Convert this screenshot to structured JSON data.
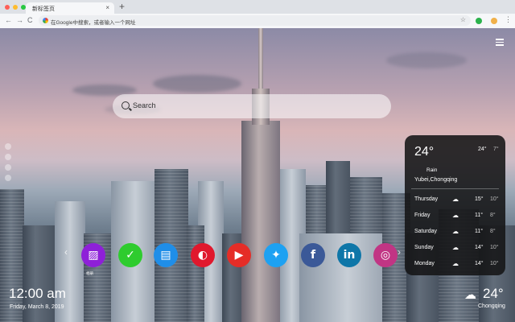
{
  "browser": {
    "tab_title": "新标签页",
    "tab_close": "×",
    "new_tab": "+",
    "back": "←",
    "forward": "→",
    "reload": "C",
    "omnibox_placeholder": "在Google中搜索，或者输入一个网址",
    "bookmark_star": "☆",
    "menu": "⋮",
    "traffic_lights": [
      "#ff5f57",
      "#febc2e",
      "#28c840"
    ]
  },
  "search": {
    "placeholder": "Search"
  },
  "weather": {
    "temp": "24°",
    "hi": "24°",
    "lo": "7°",
    "condition": "Rain",
    "location": "Yubei,Chongqing",
    "forecast": [
      {
        "day": "Thursday",
        "hi": "15°",
        "lo": "10°"
      },
      {
        "day": "Friday",
        "hi": "11°",
        "lo": "8°"
      },
      {
        "day": "Saturday",
        "hi": "11°",
        "lo": "8°"
      },
      {
        "day": "Sunday",
        "hi": "14°",
        "lo": "10°"
      },
      {
        "day": "Monday",
        "hi": "14°",
        "lo": "10°"
      }
    ]
  },
  "clock": {
    "time": "12:00 am",
    "date": "Friday, March 8, 2019"
  },
  "bottom_weather": {
    "temp": "24°",
    "location": "Chongqing"
  },
  "dock": {
    "apps": [
      {
        "name": "gallery",
        "color": "#8e20d8",
        "glyph": "▨"
      },
      {
        "name": "tasks",
        "color": "#2ecc2e",
        "glyph": "✓"
      },
      {
        "name": "news",
        "color": "#1f8ee8",
        "glyph": "▤"
      },
      {
        "name": "game",
        "color": "#e0182d",
        "glyph": "◐"
      },
      {
        "name": "youtube",
        "color": "#e52d27",
        "glyph": "▶"
      },
      {
        "name": "twitter",
        "color": "#1da1f2",
        "glyph": "✦"
      },
      {
        "name": "facebook",
        "color": "#3b5998",
        "glyph": "f"
      },
      {
        "name": "linkedin",
        "color": "#0e76a8",
        "glyph": "in"
      },
      {
        "name": "instagram",
        "color": "#c13584",
        "glyph": "◎"
      }
    ],
    "first_label": "相册"
  }
}
